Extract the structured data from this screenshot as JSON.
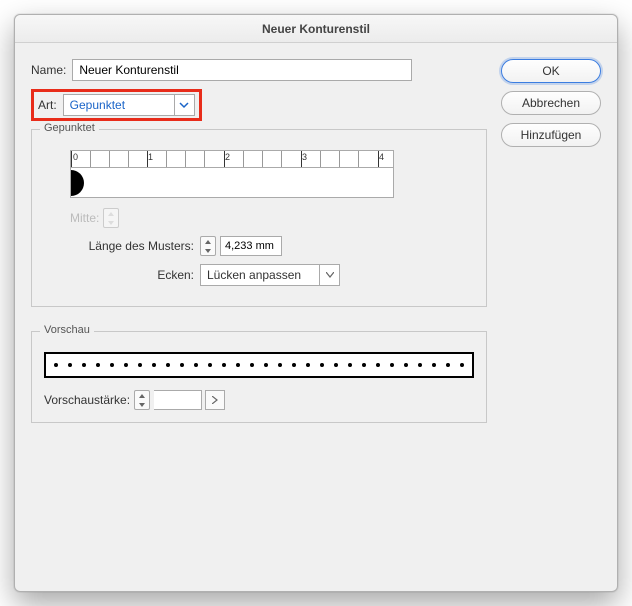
{
  "title": "Neuer Konturenstil",
  "name_label": "Name:",
  "name_value": "Neuer Konturenstil",
  "art_label": "Art:",
  "art_value": "Gepunktet",
  "buttons": {
    "ok": "OK",
    "cancel": "Abbrechen",
    "add": "Hinzufügen"
  },
  "section_label": "Gepunktet",
  "ruler_labels": [
    "0",
    "1",
    "2",
    "3",
    "4"
  ],
  "mitte_label": "Mitte:",
  "length_label": "Länge des Musters:",
  "length_value": "4,233 mm",
  "ecken_label": "Ecken:",
  "ecken_value": "Lücken anpassen",
  "preview_label": "Vorschau",
  "preview_thickness_label": "Vorschaustärke:"
}
